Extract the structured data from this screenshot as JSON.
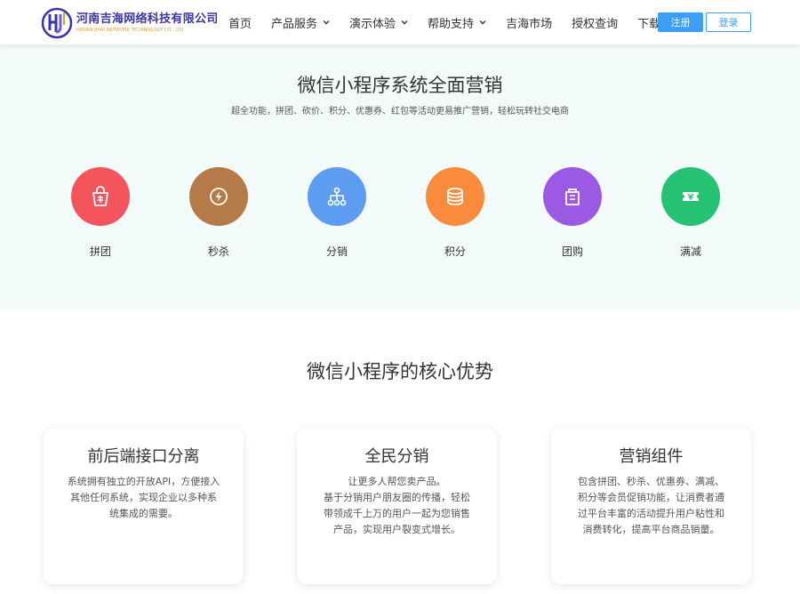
{
  "header": {
    "logo_cn": "河南吉海网络科技有限公司",
    "logo_en": "HENAN JIHAI NETWORK TECHNOLOGY CO., LTD",
    "nav": [
      {
        "label": "首页",
        "dropdown": false
      },
      {
        "label": "产品服务",
        "dropdown": true
      },
      {
        "label": "演示体验",
        "dropdown": true
      },
      {
        "label": "帮助支持",
        "dropdown": true
      },
      {
        "label": "吉海市场",
        "dropdown": false
      },
      {
        "label": "授权查询",
        "dropdown": false
      },
      {
        "label": "下载",
        "dropdown": false
      }
    ],
    "register_label": "注册",
    "login_label": "登录"
  },
  "marketing": {
    "title": "微信小程序系统全面营销",
    "subtitle": "超全功能，拼团、砍价、积分、优惠券、红包等活动更易推广营销，轻松玩转社交电商",
    "features": [
      {
        "label": "拼团",
        "icon": "group-buy-bag-icon",
        "color": "#f4545b"
      },
      {
        "label": "秒杀",
        "icon": "lightning-icon",
        "color": "#b47a47"
      },
      {
        "label": "分销",
        "icon": "distribution-tree-icon",
        "color": "#5c9df2"
      },
      {
        "label": "积分",
        "icon": "coin-stack-icon",
        "color": "#fb8b3c"
      },
      {
        "label": "团购",
        "icon": "shopping-bag-icon",
        "color": "#9c59e3"
      },
      {
        "label": "满减",
        "icon": "ticket-icon",
        "color": "#25c274"
      }
    ]
  },
  "core": {
    "title": "微信小程序的核心优势",
    "cards": [
      {
        "title": "前后端接口分离",
        "lines": [
          "系统拥有独立的开放API，方便接入",
          "其他任何系统，实现企业以多种系",
          "统集成的需要。"
        ]
      },
      {
        "title": "全民分销",
        "lines": [
          "让更多人帮您卖产品。",
          "基于分销用户朋友圈的传播，轻松",
          "带领成千上万的用户一起为您销售",
          "产品，实现用户裂变式增长。"
        ]
      },
      {
        "title": "营销组件",
        "lines": [
          "包含拼团、秒杀、优惠券、满减、",
          "积分等会员促销功能，让消费者通",
          "过平台丰富的活动提升用户粘性和",
          "消费转化，提高平台商品销量。"
        ]
      }
    ]
  }
}
